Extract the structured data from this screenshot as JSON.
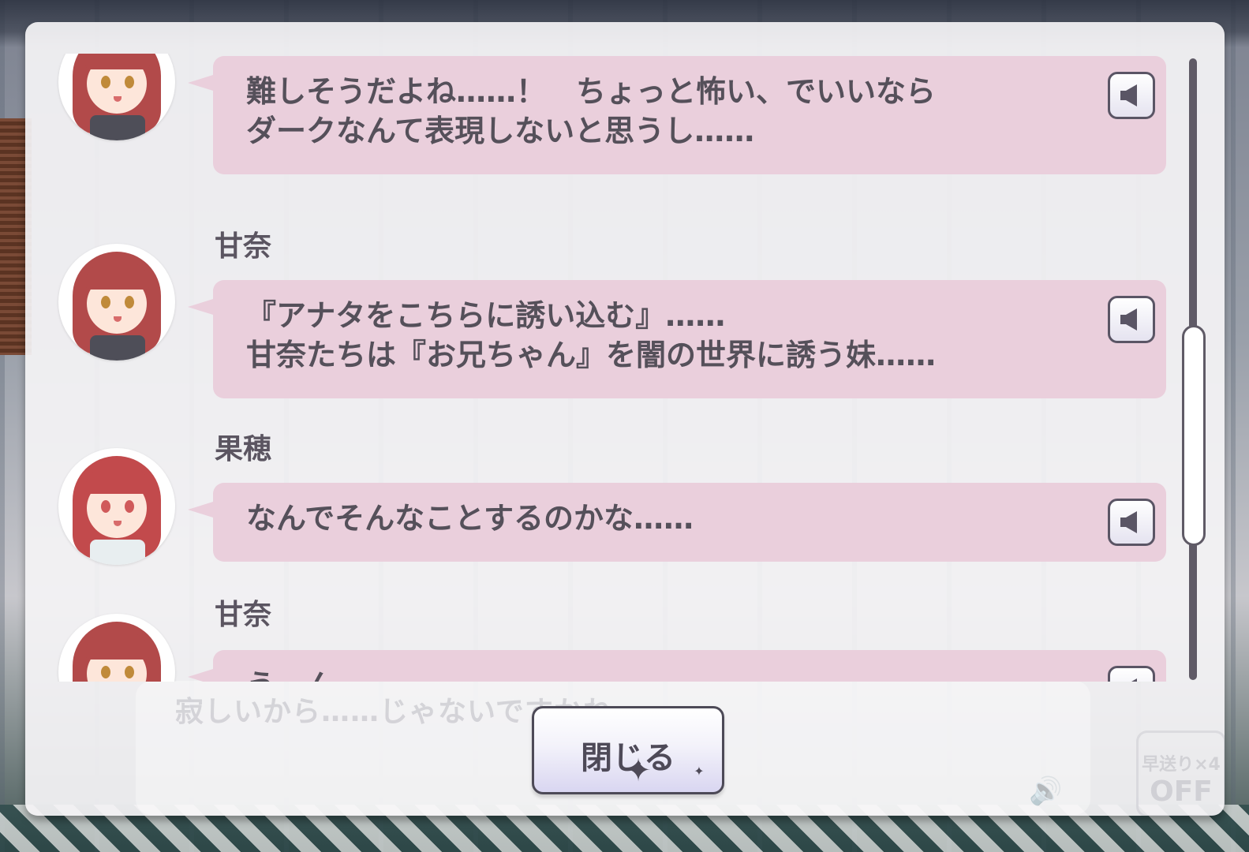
{
  "background": {
    "ghost_text": "寂しいから……じゃないですかね",
    "ghost_fast_forward_label": "早送り×4",
    "ghost_fast_forward_state": "OFF"
  },
  "log": {
    "entries": [
      {
        "speaker": "",
        "character": "amana",
        "text": "難しそうだよね……！　ちょっと怖い、でいいなら\nダークなんて表現しないと思うし……"
      },
      {
        "speaker": "甘奈",
        "character": "amana",
        "text": "『アナタをこちらに誘い込む』……\n甘奈たちは『お兄ちゃん』を闇の世界に誘う妹……"
      },
      {
        "speaker": "果穂",
        "character": "kaho",
        "text": "なんでそんなことするのかな……"
      },
      {
        "speaker": "甘奈",
        "character": "amana",
        "text": "うーん……"
      }
    ],
    "scroll_position": 0.62
  },
  "close_button": {
    "label": "閉じる"
  },
  "colors": {
    "bubble": "#eacfdc",
    "panel": "#f4f3f5",
    "text": "#55505a",
    "scroll": "#5f5a66"
  },
  "icons": {
    "voice": "speaker-icon",
    "volume": "volume-icon"
  }
}
